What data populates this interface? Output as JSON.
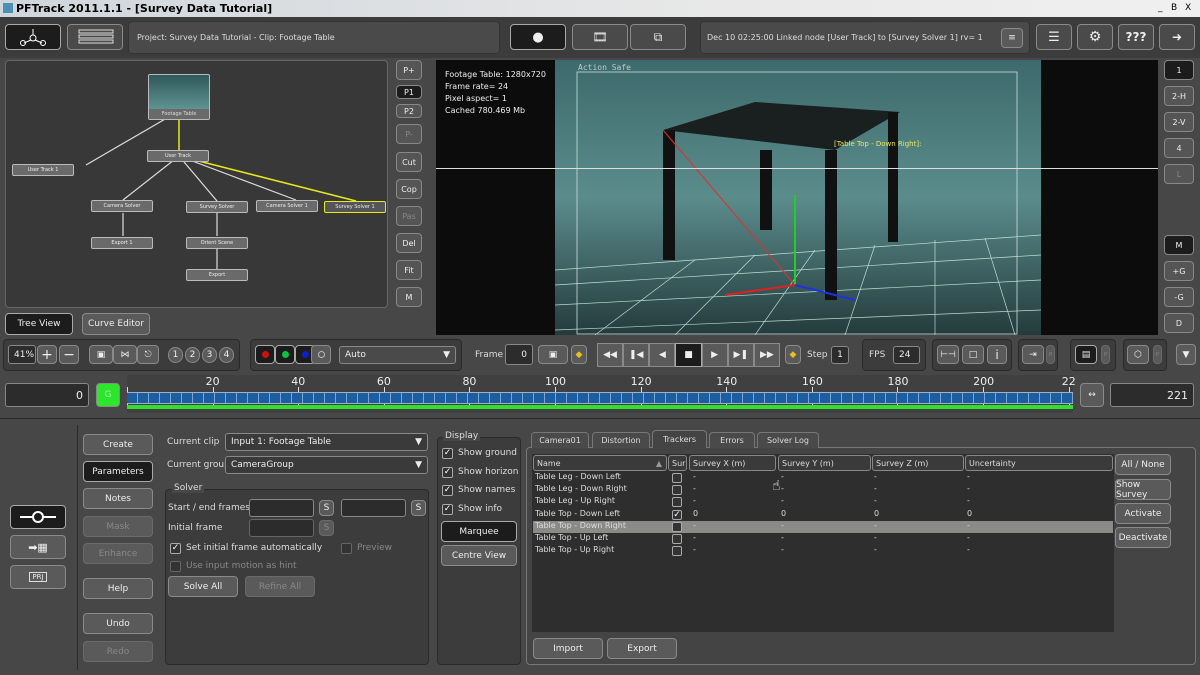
{
  "window": {
    "title": "PFTrack 2011.1.1 - [Survey Data Tutorial]",
    "controls": [
      "_",
      "B",
      "X"
    ]
  },
  "toolbar": {
    "project_info": "Project: Survey Data Tutorial - Clip: Footage Table",
    "log_message": "Dec 10 02:25:00 Linked node [User Track] to [Survey Solver 1] rv= 1",
    "help_label": "???"
  },
  "node_graph": {
    "nodes": [
      "Footage Table",
      "User Track",
      "User Track 1",
      "Camera Solver",
      "Survey Solver",
      "Camera Solver 1",
      "Survey Solver 1",
      "Export 1",
      "Orient Scene",
      "Export"
    ],
    "side_buttons": [
      "P+",
      "P1",
      "P2",
      "P-",
      "Cut",
      "Cop",
      "Pas",
      "Del",
      "Fit",
      "M"
    ],
    "tabs": [
      "Tree View",
      "Curve Editor"
    ]
  },
  "viewer": {
    "info": [
      "Footage Table: 1280x720",
      "Frame rate= 24",
      "Pixel aspect= 1",
      "Cached 780.469 Mb"
    ],
    "safe_label": "Action Safe",
    "tracker_label": "[Table Top - Down Right]:",
    "layout_buttons": [
      "1",
      "2-H",
      "2-V",
      "4",
      "L",
      "M",
      "+G",
      "-G",
      "D"
    ]
  },
  "controls": {
    "zoom": "41%",
    "view_numbers": [
      "1",
      "2",
      "3",
      "4"
    ],
    "channel_mode": "Auto",
    "frame_label": "Frame",
    "frame": "0",
    "step_label": "Step",
    "step": "1",
    "fps_label": "FPS",
    "fps": "24",
    "colors": {
      "red": "#d01010",
      "green": "#10c040",
      "blue": "#1020c0"
    }
  },
  "timeline": {
    "start": "0",
    "end": "221",
    "ticks": [
      "0",
      "20",
      "40",
      "60",
      "80",
      "100",
      "120",
      "140",
      "160",
      "180",
      "200",
      "22"
    ],
    "key_label": "G",
    "cached_fraction": 1.0
  },
  "left_buttons": [
    "Create",
    "Parameters",
    "Notes",
    "Mask",
    "Enhance",
    "Help",
    "Undo",
    "Redo"
  ],
  "params": {
    "clip_label": "Current clip",
    "clip_value": "Input 1: Footage Table",
    "group_label": "Current group",
    "group_value": "CameraGroup",
    "solver_title": "Solver",
    "start_end_label": "Start / end frames",
    "initial_frame_label": "Initial frame",
    "s_label": "S",
    "set_initial_label": "Set initial frame automatically",
    "preview_label": "Preview",
    "use_motion_label": "Use input motion as hint",
    "solve_all": "Solve All",
    "refine_all": "Refine All"
  },
  "display": {
    "title": "Display",
    "options": [
      {
        "label": "Show ground",
        "checked": true
      },
      {
        "label": "Show horizon",
        "checked": true
      },
      {
        "label": "Show names",
        "checked": true
      },
      {
        "label": "Show info",
        "checked": true
      }
    ],
    "marquee": "Marquee",
    "centre_view": "Centre View"
  },
  "trackers": {
    "tabs": [
      "Camera01",
      "Distortion",
      "Trackers",
      "Errors",
      "Solver Log"
    ],
    "active_tab": "Trackers",
    "columns": [
      "Name",
      "Sur",
      "Survey X (m)",
      "Survey Y (m)",
      "Survey Z (m)",
      "Uncertainty"
    ],
    "rows": [
      {
        "name": "Table Leg - Down Left",
        "survey": false,
        "x": "-",
        "y": "-",
        "z": "-",
        "u": "-"
      },
      {
        "name": "Table Leg - Down Right",
        "survey": false,
        "x": "-",
        "y": "-",
        "z": "-",
        "u": "-"
      },
      {
        "name": "Table Leg - Up Right",
        "survey": false,
        "x": "-",
        "y": "-",
        "z": "-",
        "u": "-"
      },
      {
        "name": "Table Top - Down Left",
        "survey": true,
        "x": "0",
        "y": "0",
        "z": "0",
        "u": "0"
      },
      {
        "name": "Table Top - Down Right",
        "survey": false,
        "x": "-",
        "y": "-",
        "z": "-",
        "u": "-",
        "selected": true
      },
      {
        "name": "Table Top - Up Left",
        "survey": false,
        "x": "-",
        "y": "-",
        "z": "-",
        "u": "-"
      },
      {
        "name": "Table Top - Up Right",
        "survey": false,
        "x": "-",
        "y": "-",
        "z": "-",
        "u": "-"
      }
    ],
    "side_buttons": [
      "All / None",
      "Show Survey",
      "Activate",
      "Deactivate"
    ],
    "import": "Import",
    "export": "Export"
  }
}
